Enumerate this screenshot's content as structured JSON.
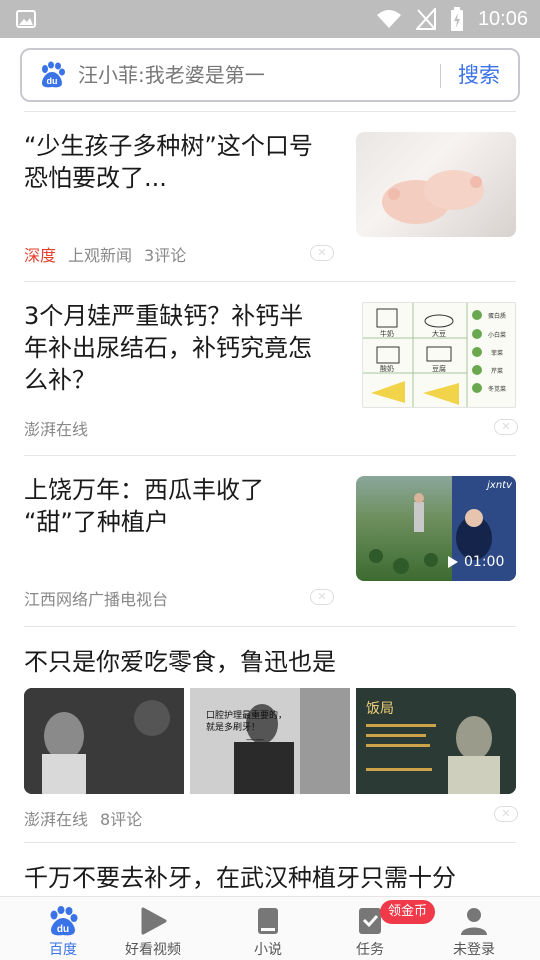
{
  "status_bar": {
    "time": "10:06"
  },
  "search": {
    "query": "汪小菲:我老婆是第一",
    "button_label": "搜索"
  },
  "feed": [
    {
      "title_lines": [
        "“少生孩子多种树”这个口号",
        "恐怕要改了..."
      ],
      "tag": "深度",
      "source": "上观新闻",
      "comments": "3评论"
    },
    {
      "title_lines": [
        "3个月娃严重缺钙？补钙半",
        "年补出尿结石，补钙究竟怎",
        "么补？"
      ],
      "source": "澎湃在线",
      "thumb_labels": [
        "牛奶",
        "大豆",
        "酸奶",
        "豆腐",
        "蛋白质",
        "小白菜",
        "菲菜",
        "芹菜",
        "冬苋菜"
      ]
    },
    {
      "title_lines": [
        "上饶万年：西瓜丰收了",
        "“甜”了种植户"
      ],
      "source": "江西网络广播电视台",
      "video_duration": "01:00",
      "channel_logo": "jxntv"
    },
    {
      "title_lines": [
        "不只是你爱吃零食，鲁迅也是"
      ],
      "source": "澎湃在线",
      "comments": "8评论",
      "image2_caption_lines": [
        "口腔护理最重要的，",
        "就是多刷牙！",
        "——"
      ],
      "image3_caption": "饭局"
    },
    {
      "title_lines": [
        "千万不要去补牙，在武汉种植牙只需十分"
      ]
    }
  ],
  "bottom_nav": [
    {
      "label": "百度",
      "icon": "baidu-paw-icon",
      "active": true
    },
    {
      "label": "好看视频",
      "icon": "play-icon"
    },
    {
      "label": "小说",
      "icon": "book-icon"
    },
    {
      "label": "任务",
      "icon": "task-icon",
      "badge": "领金币"
    },
    {
      "label": "未登录",
      "icon": "user-icon"
    }
  ],
  "colors": {
    "accent": "#3a73e8",
    "tag_red": "#e3412c",
    "badge_red": "#f03a4a",
    "status_bar": "#bdbdbd"
  }
}
